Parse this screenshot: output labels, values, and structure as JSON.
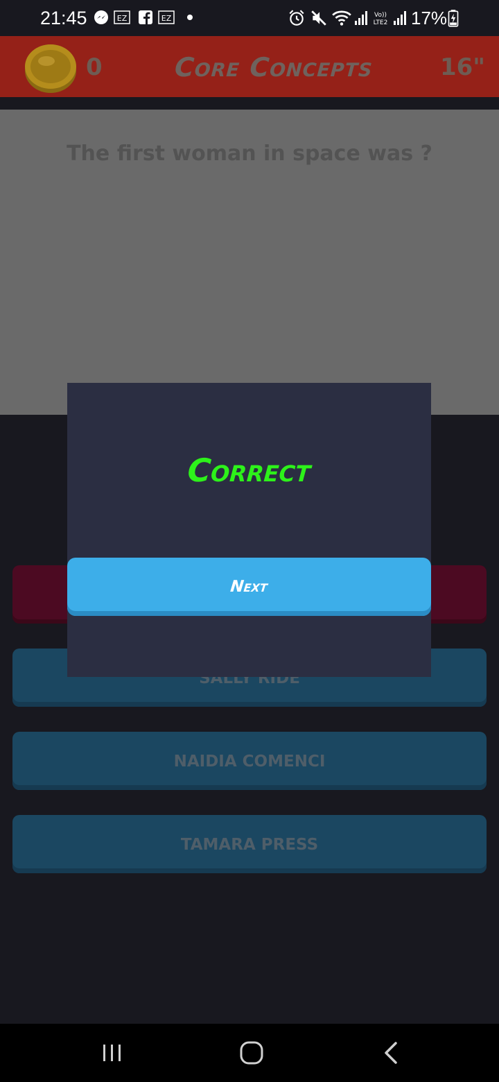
{
  "status_bar": {
    "time": "21:45",
    "battery": "17%",
    "icons": [
      "messenger-icon",
      "ez-icon",
      "facebook-icon",
      "ez-icon",
      "dot-icon",
      "alarm-icon",
      "mute-icon",
      "wifi-icon",
      "signal-icon",
      "volte-icon",
      "signal-icon",
      "battery-charging-icon"
    ]
  },
  "header": {
    "coins": "0",
    "title": "Core Concepts",
    "timer": "16\""
  },
  "question": {
    "text": "The first woman in space was ?"
  },
  "answers": [
    {
      "label": ""
    },
    {
      "label": "SALLY RIDE"
    },
    {
      "label": "NAIDIA COMENCI"
    },
    {
      "label": "TAMARA PRESS"
    }
  ],
  "modal": {
    "title": "Correct",
    "button_label": "Next"
  },
  "colors": {
    "header_bg": "#952118",
    "correct_text": "#2df21a",
    "next_button": "#3daee9",
    "modal_bg": "#2b2e42"
  }
}
